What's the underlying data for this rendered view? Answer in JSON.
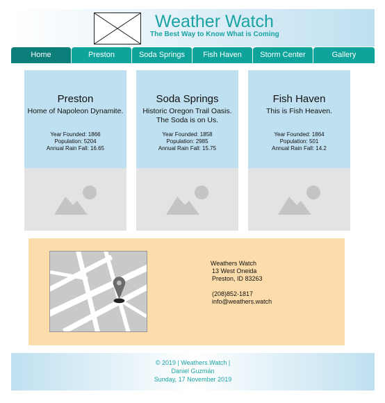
{
  "header": {
    "title": "Weather Watch",
    "tagline": "The Best Way to Know What is Coming",
    "logo_icon": "image-placeholder-icon"
  },
  "nav": {
    "items": [
      "Home",
      "Preston",
      "Soda Springs",
      "Fish Haven",
      "Storm Center",
      "Gallery"
    ],
    "active": "Home"
  },
  "towns": [
    {
      "name": "Preston",
      "description": "Home of Napoleon Dynamite.",
      "founded": "Year Founded: 1866",
      "population": "Population: 5204",
      "rainfall": "Annual Rain Fall: 16.65",
      "image_icon": "image-placeholder-icon"
    },
    {
      "name": "Soda Springs",
      "description": "Historic Oregon Trail Oasis. The Soda is on Us.",
      "founded": "Year Founded: 1858",
      "population": "Population: 2985",
      "rainfall": "Annual Rain Fall: 15.75",
      "image_icon": "image-placeholder-icon"
    },
    {
      "name": "Fish Haven",
      "description": "This is Fish Heaven.",
      "founded": "Year Founded: 1864",
      "population": "Population: 501",
      "rainfall": "Annual Rain Fall: 14.2",
      "image_icon": "image-placeholder-icon"
    }
  ],
  "contact": {
    "map_icon": "map-pin-icon",
    "company": "Weathers Watch",
    "street": "13 West Oneida",
    "city": "Preston, ID 83263",
    "phone": "(208)852-1817",
    "email": "info@weathers.watch"
  },
  "footer": {
    "copyright": "© 2019 | Weathers.Watch |",
    "author": "Daniel Guzmán",
    "date": "Sunday, 17 November 2019"
  },
  "colors": {
    "teal": "#1aa3a3",
    "nav_bg": "#0fa49b",
    "nav_active": "#0b7e79",
    "card_bg": "#bfe0f1",
    "contact_bg": "#fcdcaa"
  }
}
